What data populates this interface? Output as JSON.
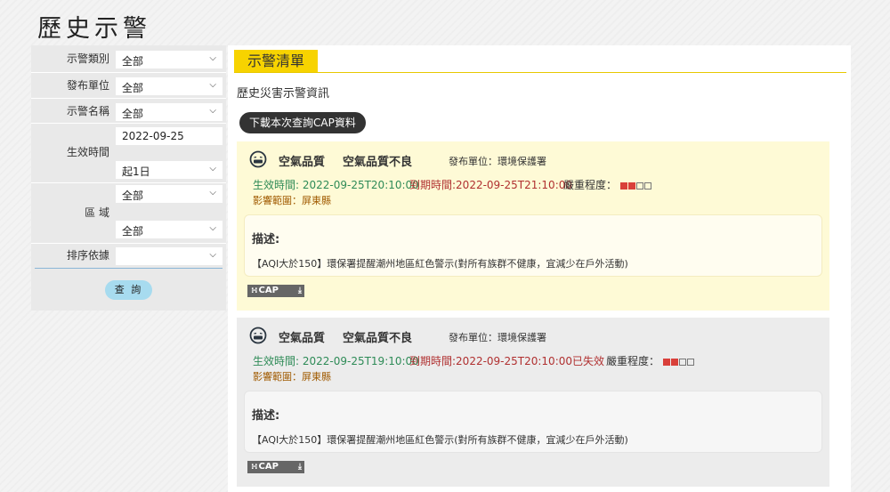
{
  "page_title": "歷史示警",
  "filters": {
    "alert_type": {
      "label": "示警類別",
      "value": "全部"
    },
    "issuer": {
      "label": "發布單位",
      "value": "全部"
    },
    "alert_name": {
      "label": "示警名稱",
      "value": "全部"
    },
    "effective_time": {
      "label": "生效時間",
      "date": "2022-09-25",
      "range": "起1日"
    },
    "region": {
      "label": "區 域",
      "county": "全部",
      "town": "全部"
    },
    "sort": {
      "label": "排序依據",
      "value": ""
    },
    "query_label": "查 詢"
  },
  "main": {
    "tab_label": "示警清單",
    "subtitle": "歷史災害示警資訊",
    "download_label": "下載本次查詢CAP資料",
    "desc_label": "描述:",
    "cap_label": "CAP",
    "alerts": [
      {
        "category": "空氣品質",
        "name": "空氣品質不良",
        "issuer": "發布單位：環境保護署",
        "effective": "生效時間: 2022-09-25T20:10:00",
        "expires": "到期時間:2022-09-25T21:10:00",
        "severity_label": "嚴重程度：",
        "severity_level": 2,
        "severity_max": 4,
        "area": "影響範圍：屏東縣",
        "description": "【AQI大於150】環保署提醒潮州地區紅色警示(對所有族群不健康，宜減少在戶外活動)"
      },
      {
        "category": "空氣品質",
        "name": "空氣品質不良",
        "issuer": "發布單位：環境保護署",
        "effective": "生效時間: 2022-09-25T19:10:00",
        "expires": "到期時間:2022-09-25T20:10:00已失效",
        "severity_label": "嚴重程度：",
        "severity_level": 2,
        "severity_max": 4,
        "area": "影響範圍：屏東縣",
        "description": "【AQI大於150】環保署提醒潮州地區紅色警示(對所有族群不健康，宜減少在戶外活動)"
      }
    ]
  },
  "colors": {
    "tab_accent": "#f7d300",
    "active_card_bg": "#fefad6",
    "expired_card_bg": "#ececec",
    "effective_text": "#2e8b57",
    "expires_text": "#b03030",
    "severity_on": "#d9403a"
  },
  "icons": {
    "alert_category": "sick-face-icon",
    "cap_feed": "rss-icon",
    "download": "download-arrow-icon"
  }
}
